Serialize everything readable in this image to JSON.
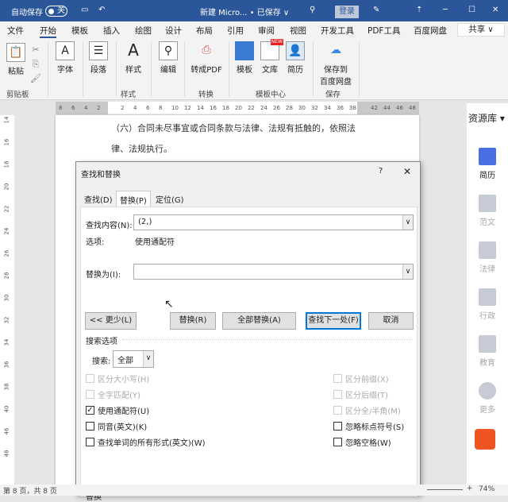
{
  "titlebar": {
    "autosave_label": "自动保存",
    "autosave_state": "关",
    "doc_title": "新建 Micro...  • 已保存 ∨",
    "login": "登录"
  },
  "tabs": [
    "文件",
    "开始",
    "模板",
    "插入",
    "绘图",
    "设计",
    "布局",
    "引用",
    "审阅",
    "视图",
    "开发工具",
    "PDF工具",
    "百度网盘"
  ],
  "share": "共享",
  "ribbon": {
    "paste": "粘贴",
    "font": "字体",
    "paragraph": "段落",
    "styles": "样式",
    "edit": "编辑",
    "to_pdf": "转成PDF",
    "template": "模板",
    "library": "文库",
    "new_badge": "NEW",
    "resume": "简历",
    "save_to": "保存到",
    "baidu": "百度网盘",
    "groups": {
      "clipboard": "剪贴板",
      "styles": "样式",
      "convert": "转换",
      "template_center": "模板中心",
      "save": "保存"
    }
  },
  "ruler": {
    "left": [
      "8",
      "6",
      "4",
      "2"
    ],
    "right": [
      "2",
      "4",
      "6",
      "8",
      "10",
      "12",
      "14",
      "16",
      "18",
      "20",
      "22",
      "24",
      "26",
      "28",
      "30",
      "32",
      "34",
      "36",
      "38"
    ],
    "margin": [
      "42",
      "44",
      "46",
      "48"
    ],
    "vertical": [
      "14",
      "16",
      "18",
      "20",
      "22",
      "24",
      "26",
      "28",
      "30",
      "32",
      "34",
      "36",
      "38",
      "40",
      "46",
      "48"
    ]
  },
  "document": {
    "line1": "（六）合同未尽事宜或合同条款与法律、法规有抵触的，依照法",
    "line2": "律、法规执行。"
  },
  "dialog": {
    "title": "查找和替换",
    "help": "?",
    "close": "✕",
    "tabs": [
      "查找(D)",
      "替换(P)",
      "定位(G)"
    ],
    "find_label": "查找内容(N):",
    "find_value": "(2,)",
    "options_label": "选项:",
    "options_value": "使用通配符",
    "replace_label": "替换为(I):",
    "replace_value": "",
    "buttons": {
      "less": "<< 更少(L)",
      "replace": "替换(R)",
      "replace_all": "全部替换(A)",
      "find_next": "查找下一处(F)",
      "cancel": "取消"
    },
    "search_options": "搜索选项",
    "search_label": "搜索:",
    "search_value": "全部",
    "left_checks": [
      {
        "label": "区分大小写(H)",
        "checked": false,
        "disabled": true
      },
      {
        "label": "全字匹配(Y)",
        "checked": false,
        "disabled": true
      },
      {
        "label": "使用通配符(U)",
        "checked": true,
        "disabled": false
      },
      {
        "label": "同音(英文)(K)",
        "checked": false,
        "disabled": false
      },
      {
        "label": "查找单词的所有形式(英文)(W)",
        "checked": false,
        "disabled": false
      }
    ],
    "right_checks": [
      {
        "label": "区分前缀(X)",
        "checked": false,
        "disabled": true
      },
      {
        "label": "区分后缀(T)",
        "checked": false,
        "disabled": true
      },
      {
        "label": "区分全/半角(M)",
        "checked": false,
        "disabled": true
      },
      {
        "label": "忽略标点符号(S)",
        "checked": false,
        "disabled": false
      },
      {
        "label": "忽略空格(W)",
        "checked": false,
        "disabled": false
      }
    ],
    "replace_section": "替换"
  },
  "pane": {
    "title": "资源库 ▾",
    "items": [
      "简历",
      "范文",
      "法律",
      "行政",
      "教育",
      "更多"
    ]
  },
  "status": {
    "page": "第 8 页，共 8 页",
    "zoom": "74%"
  }
}
